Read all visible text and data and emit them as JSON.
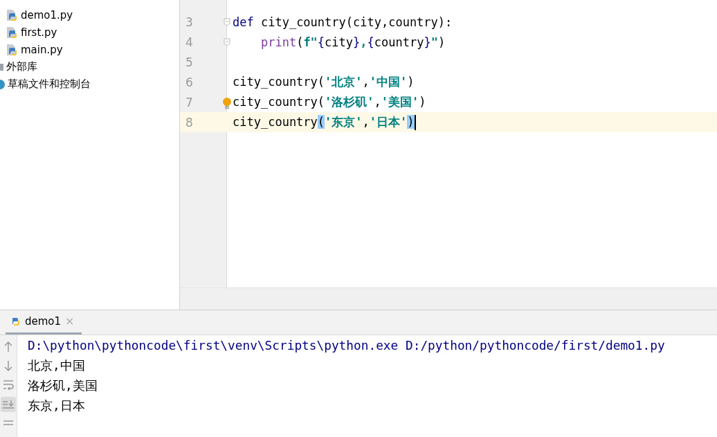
{
  "project_tree": {
    "items": [
      {
        "kind": "python-file",
        "label": "demo1.py"
      },
      {
        "kind": "python-file",
        "label": "first.py"
      },
      {
        "kind": "python-file",
        "label": "main.py"
      }
    ],
    "root_items": [
      {
        "kind": "library",
        "label": "外部库"
      },
      {
        "kind": "scratch",
        "label": "草稿文件和控制台"
      }
    ]
  },
  "editor": {
    "lines": [
      {
        "number": "3",
        "current": false,
        "fold": true,
        "bulb": false,
        "tokens": [
          {
            "text": "def ",
            "kind": "keyword"
          },
          {
            "text": "city_country(city,country):",
            "kind": "plain"
          }
        ]
      },
      {
        "number": "4",
        "current": false,
        "fold": true,
        "bulb": false,
        "indented": true,
        "tokens": [
          {
            "text": "print",
            "kind": "builtin"
          },
          {
            "text": "(",
            "kind": "plain"
          },
          {
            "text": "f\"",
            "kind": "string"
          },
          {
            "text": "{",
            "kind": "keyword"
          },
          {
            "text": "city",
            "kind": "plain"
          },
          {
            "text": "}",
            "kind": "keyword"
          },
          {
            "text": ",",
            "kind": "string"
          },
          {
            "text": "{",
            "kind": "keyword"
          },
          {
            "text": "country",
            "kind": "plain"
          },
          {
            "text": "}",
            "kind": "keyword"
          },
          {
            "text": "\"",
            "kind": "string"
          },
          {
            "text": ")",
            "kind": "plain"
          }
        ]
      },
      {
        "number": "5",
        "current": false,
        "fold": false,
        "bulb": false
      },
      {
        "number": "6",
        "current": false,
        "fold": false,
        "bulb": false,
        "tokens": [
          {
            "text": "city_country(",
            "kind": "plain"
          },
          {
            "text": "'北京'",
            "kind": "string"
          },
          {
            "text": ",",
            "kind": "plain"
          },
          {
            "text": "'中国'",
            "kind": "string"
          },
          {
            "text": ")",
            "kind": "plain"
          }
        ]
      },
      {
        "number": "7",
        "current": false,
        "fold": false,
        "bulb": true,
        "tokens": [
          {
            "text": "city_country(",
            "kind": "plain"
          },
          {
            "text": "'洛杉矶'",
            "kind": "string"
          },
          {
            "text": ",",
            "kind": "plain"
          },
          {
            "text": "'美国'",
            "kind": "string"
          },
          {
            "text": ")",
            "kind": "plain"
          }
        ]
      },
      {
        "number": "8",
        "current": true,
        "fold": false,
        "bulb": false,
        "tokens": [
          {
            "text": "city_country",
            "kind": "plain"
          },
          {
            "text": "(",
            "kind": "matched-brace"
          },
          {
            "text": "'东京'",
            "kind": "string"
          },
          {
            "text": ",",
            "kind": "plain"
          },
          {
            "text": "'日本'",
            "kind": "string"
          },
          {
            "text": ")",
            "kind": "matched-brace"
          }
        ]
      }
    ]
  },
  "run_panel": {
    "tabs": [
      {
        "label": "demo1",
        "close": "×",
        "selected": true
      }
    ],
    "console": [
      {
        "kind": "command",
        "text": "D:\\python\\pythoncode\\first\\venv\\Scripts\\python.exe D:/python/pythoncode/first/demo1.py"
      },
      {
        "kind": "output",
        "text": "北京,中国"
      },
      {
        "kind": "output",
        "text": "洛杉矶,美国"
      },
      {
        "kind": "output",
        "text": "东京,日本"
      }
    ]
  }
}
